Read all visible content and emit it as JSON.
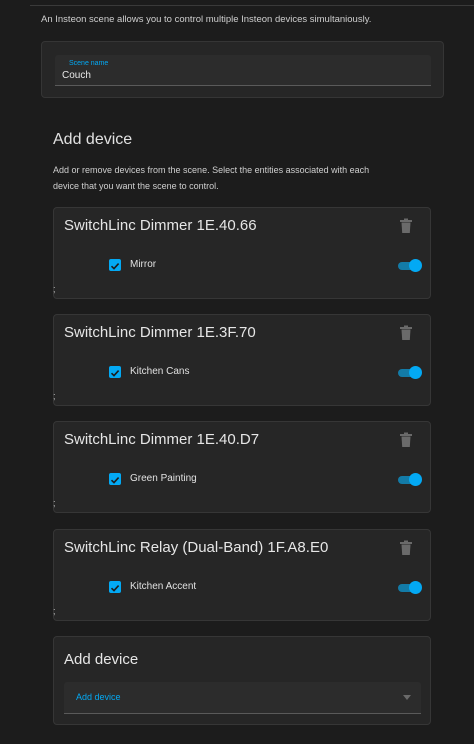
{
  "intro_text": "An Insteon scene allows you to control multiple Insteon devices simultaniously.",
  "scene_name": {
    "label": "Scene name",
    "value": "Couch"
  },
  "add_section": {
    "title": "Add device",
    "description": "Add or remove devices from the scene. Select the entities associated with each device that you want the scene to control."
  },
  "devices": [
    {
      "title": "SwitchLinc Dimmer 1E.40.66",
      "entity": "Mirror",
      "checked": true,
      "on": true,
      "trailing": ";"
    },
    {
      "title": "SwitchLinc Dimmer 1E.3F.70",
      "entity": "Kitchen Cans",
      "checked": true,
      "on": true,
      "trailing": ";"
    },
    {
      "title": "SwitchLinc Dimmer 1E.40.D7",
      "entity": "Green Painting",
      "checked": true,
      "on": true,
      "trailing": ";"
    },
    {
      "title": "SwitchLinc Relay (Dual-Band) 1F.A8.E0",
      "entity": "Kitchen Accent",
      "checked": true,
      "on": true,
      "trailing": ";"
    }
  ],
  "add_card": {
    "title": "Add device",
    "select_text": "Add device"
  },
  "icons": {
    "delete": "trash-icon",
    "checkbox": "checkbox-checked-icon",
    "toggle": "toggle-switch",
    "dropdown": "chevron-down-icon"
  },
  "colors": {
    "background": "#1c1c1c",
    "card": "#262626",
    "accent": "#03a9f4"
  }
}
